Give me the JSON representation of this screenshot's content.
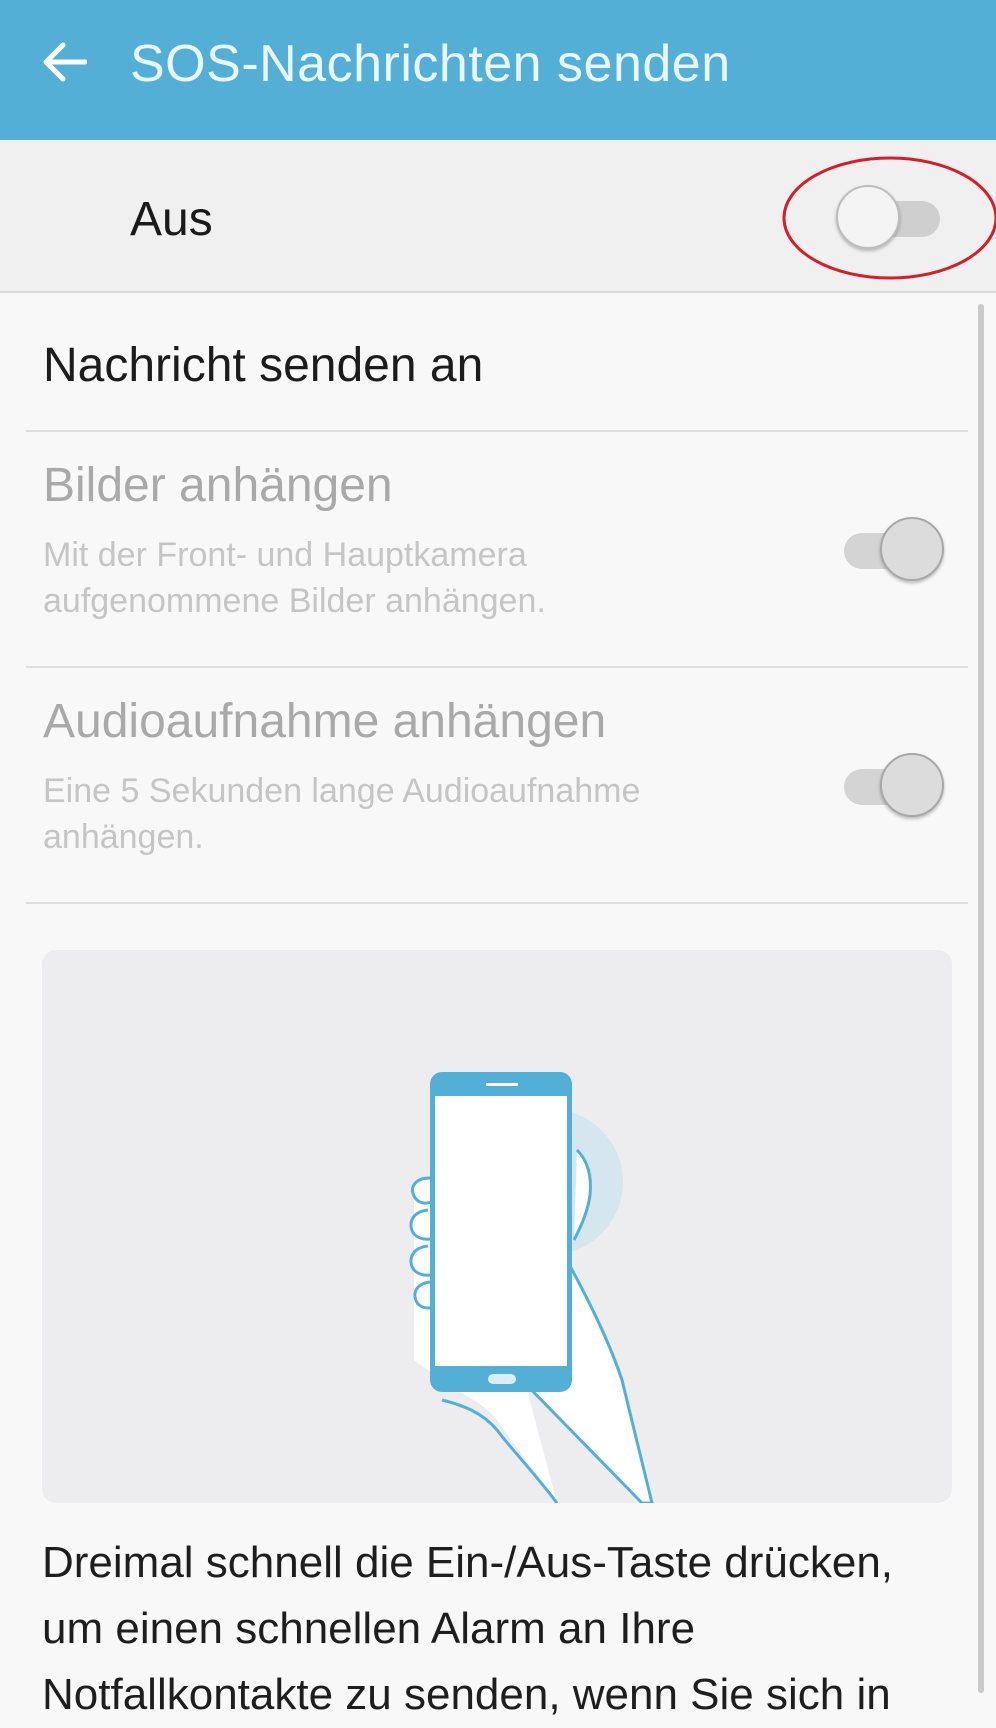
{
  "app_bar": {
    "title": "SOS-Nachrichten senden",
    "back_icon": "arrow-left-icon",
    "background": "#54afd7"
  },
  "master_switch": {
    "label": "Aus",
    "state": "off"
  },
  "settings": {
    "send_to": {
      "title": "Nachricht senden an"
    },
    "attach_pictures": {
      "title": "Bilder anhängen",
      "summary": "Mit der Front- und Hauptkamera aufgenommene Bilder anhängen.",
      "state": "on",
      "enabled": false
    },
    "attach_audio": {
      "title": "Audioaufnahme anhängen",
      "summary": "Eine 5 Sekunden lange Audioaufnahme anhängen.",
      "state": "on",
      "enabled": false
    }
  },
  "illustration": {
    "icon": "hand-holding-phone-icon",
    "accent": "#54afd7"
  },
  "description": "Dreimal schnell die Ein-/Aus-Taste drücken, um einen schnellen Alarm an Ihre Notfallkontakte zu senden, wenn Sie sich in"
}
